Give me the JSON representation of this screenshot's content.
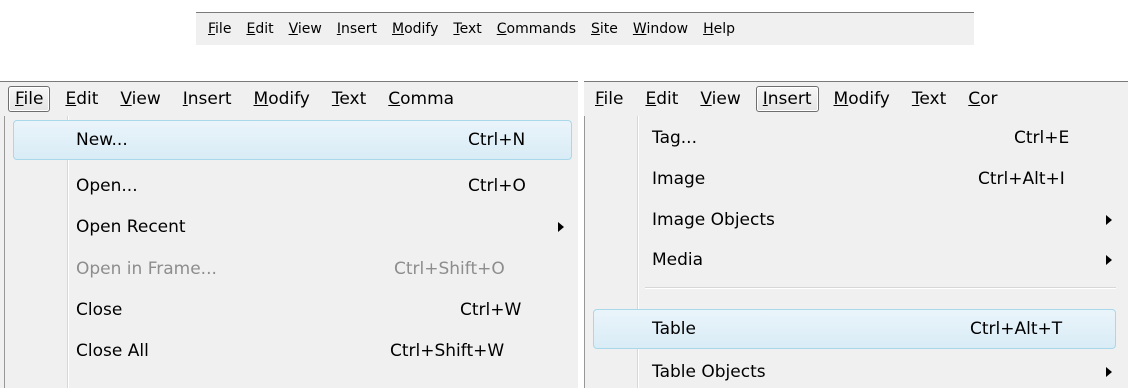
{
  "top_menubar": {
    "items": [
      {
        "pre": "",
        "key": "F",
        "post": "ile"
      },
      {
        "pre": "",
        "key": "E",
        "post": "dit"
      },
      {
        "pre": "",
        "key": "V",
        "post": "iew"
      },
      {
        "pre": "",
        "key": "I",
        "post": "nsert"
      },
      {
        "pre": "",
        "key": "M",
        "post": "odify"
      },
      {
        "pre": "",
        "key": "T",
        "post": "ext"
      },
      {
        "pre": "",
        "key": "C",
        "post": "ommands"
      },
      {
        "pre": "",
        "key": "S",
        "post": "ite"
      },
      {
        "pre": "",
        "key": "W",
        "post": "indow"
      },
      {
        "pre": "",
        "key": "H",
        "post": "elp"
      }
    ]
  },
  "file_panel": {
    "menubar": [
      {
        "key": "F",
        "post": "ile"
      },
      {
        "key": "E",
        "post": "dit"
      },
      {
        "key": "V",
        "post": "iew"
      },
      {
        "key": "I",
        "post": "nsert"
      },
      {
        "key": "M",
        "post": "odify"
      },
      {
        "key": "T",
        "post": "ext"
      },
      {
        "key": "C",
        "post": "omma"
      }
    ],
    "items": [
      {
        "label": "New...",
        "shortcut": "Ctrl+N"
      },
      {
        "label": "Open...",
        "shortcut": "Ctrl+O"
      },
      {
        "label": "Open Recent",
        "shortcut": ""
      },
      {
        "label": "Open in Frame...",
        "shortcut": "Ctrl+Shift+O"
      },
      {
        "label": "Close",
        "shortcut": "Ctrl+W"
      },
      {
        "label": "Close All",
        "shortcut": "Ctrl+Shift+W"
      }
    ]
  },
  "insert_panel": {
    "menubar": [
      {
        "key": "F",
        "post": "ile"
      },
      {
        "key": "E",
        "post": "dit"
      },
      {
        "key": "V",
        "post": "iew"
      },
      {
        "key": "I",
        "post": "nsert"
      },
      {
        "key": "M",
        "post": "odify"
      },
      {
        "key": "T",
        "post": "ext"
      },
      {
        "key": "C",
        "post": "or"
      }
    ],
    "items": [
      {
        "label": "Tag...",
        "shortcut": "Ctrl+E"
      },
      {
        "label": "Image",
        "shortcut": "Ctrl+Alt+I"
      },
      {
        "label": "Image Objects",
        "shortcut": ""
      },
      {
        "label": "Media",
        "shortcut": ""
      },
      {
        "label": "Table",
        "shortcut": "Ctrl+Alt+T"
      },
      {
        "label": "Table Objects",
        "shortcut": ""
      }
    ]
  },
  "colors": {
    "menu_bg": "#f0f0f0",
    "highlight_border": "#a8d8ea",
    "highlight_fill": "#d9ecf6",
    "disabled_text": "#8d8d8d"
  }
}
